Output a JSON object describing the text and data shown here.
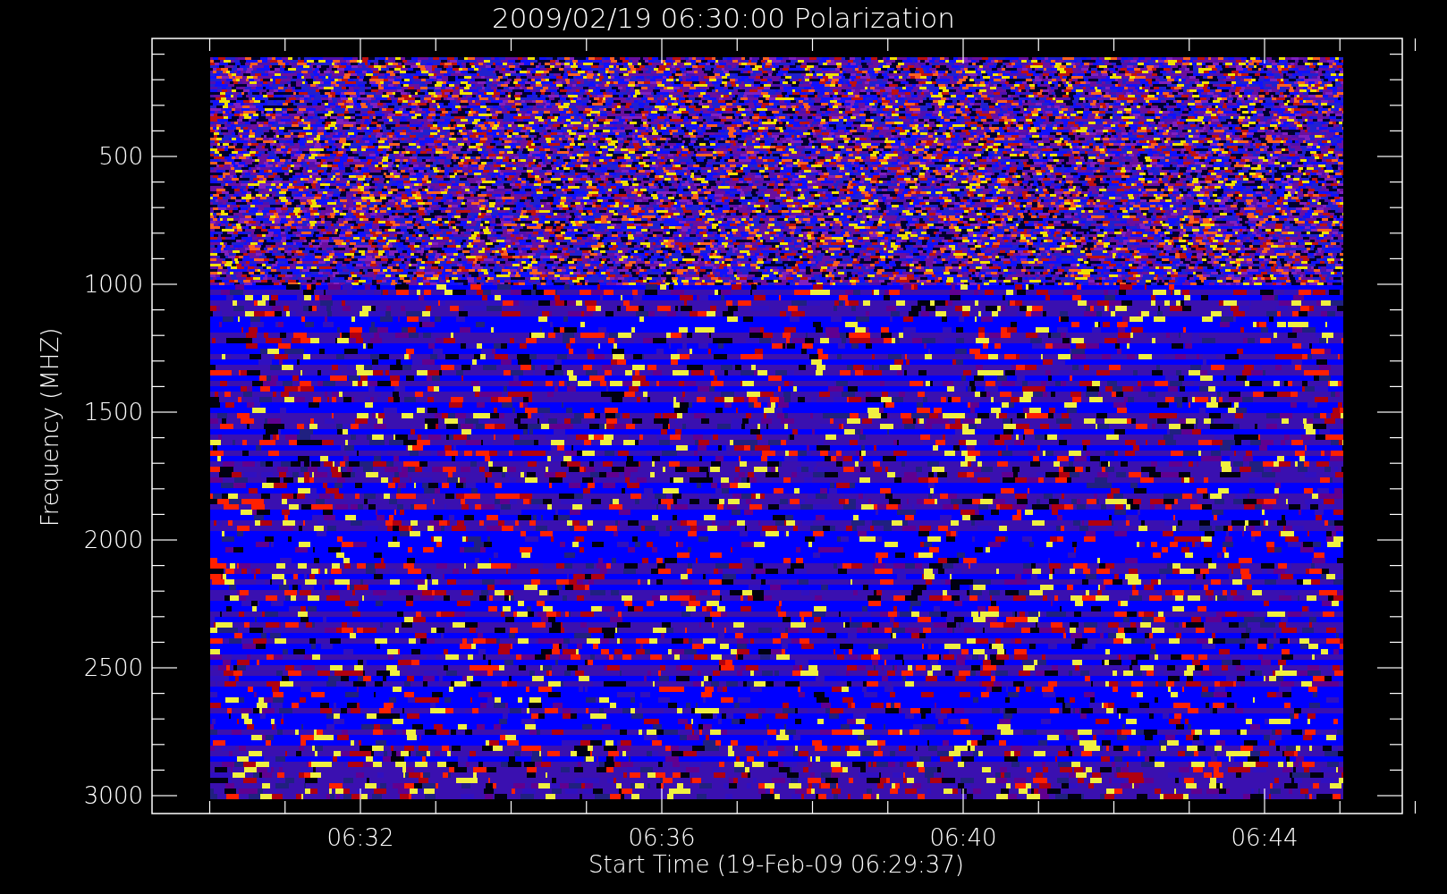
{
  "title": "2009/02/19 06:30:00 Polarization",
  "y_axis": {
    "label": "Frequency (MHZ)",
    "ticks": [
      "500",
      "1000",
      "1500",
      "2000",
      "2500",
      "3000"
    ]
  },
  "x_axis": {
    "label": "Start Time (19-Feb-09 06:29:37)",
    "ticks": [
      "06:32",
      "06:36",
      "06:40",
      "06:44"
    ]
  }
}
